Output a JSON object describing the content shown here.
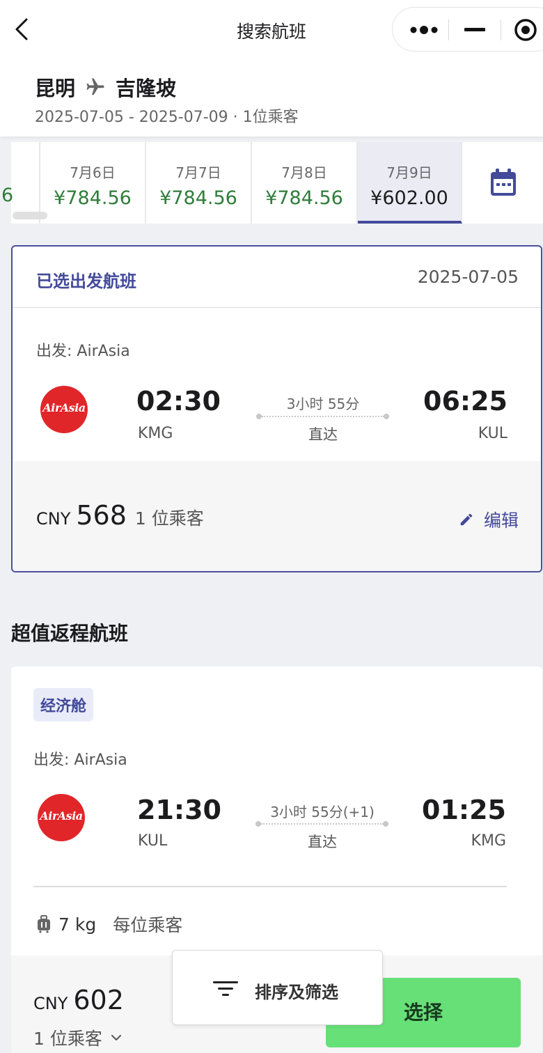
{
  "nav": {
    "title": "搜索航班"
  },
  "route": {
    "origin": "昆明",
    "destination": "吉隆坡",
    "subtitle": "2025-07-05 - 2025-07-09 · 1位乘客"
  },
  "date_strip": {
    "partial_price": "6",
    "dates": [
      {
        "date": "7月6日",
        "price": "¥784.56"
      },
      {
        "date": "7月7日",
        "price": "¥784.56"
      },
      {
        "date": "7月8日",
        "price": "¥784.56"
      },
      {
        "date": "7月9日",
        "price": "¥602.00",
        "selected": true
      }
    ]
  },
  "selected_outbound": {
    "title": "已选出发航班",
    "date": "2025-07-05",
    "departure_label": "出发: AirAsia",
    "airline_logo_text": "AirAsia",
    "dep_time": "02:30",
    "dep_code": "KMG",
    "duration": "3小时 55分",
    "stops": "直达",
    "arr_time": "06:25",
    "arr_code": "KUL",
    "currency": "CNY",
    "price": "568",
    "passengers": "1 位乘客",
    "edit_label": "编辑"
  },
  "return_section": {
    "title": "超值返程航班",
    "flight": {
      "cabin": "经济舱",
      "departure_label": "出发: AirAsia",
      "airline_logo_text": "AirAsia",
      "dep_time": "21:30",
      "dep_code": "KUL",
      "duration": "3小时 55分(+1)",
      "stops": "直达",
      "arr_time": "01:25",
      "arr_code": "KMG",
      "baggage": "7 kg",
      "baggage_note": "每位乘客",
      "currency": "CNY",
      "price": "602",
      "passengers": "1 位乘客",
      "select_label": "选择"
    }
  },
  "sort_filter": {
    "label": "排序及筛选"
  },
  "colors": {
    "brand": "#434a9a",
    "price_green": "#2f7d3a",
    "select_green": "#68e078",
    "airasia_red": "#e1262a"
  }
}
